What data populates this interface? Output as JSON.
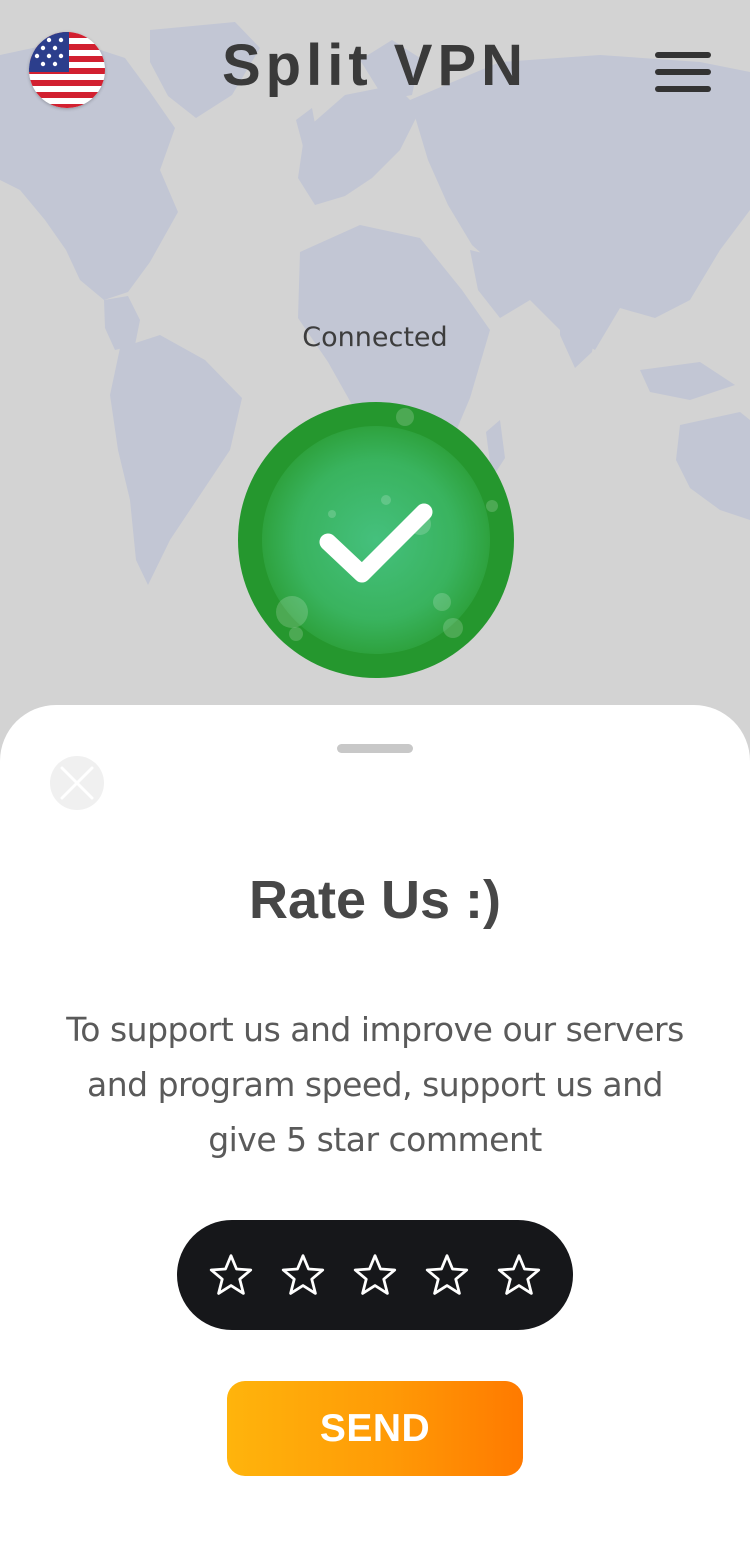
{
  "header": {
    "title": "Split VPN",
    "flag_icon": "us-flag-icon",
    "menu_icon": "hamburger-menu-icon"
  },
  "connection": {
    "status": "Connected",
    "button_icon": "checkmark-icon",
    "color": "#2ea838"
  },
  "rating_sheet": {
    "title": "Rate Us :)",
    "description": "To support us and improve our servers and program speed, support us and give 5 star comment",
    "stars_total": 5,
    "stars_selected": 0,
    "star_icon": "star-outline-icon",
    "send_label": "SEND",
    "close_icon": "close-icon",
    "accent_color": "#ff9a06"
  }
}
